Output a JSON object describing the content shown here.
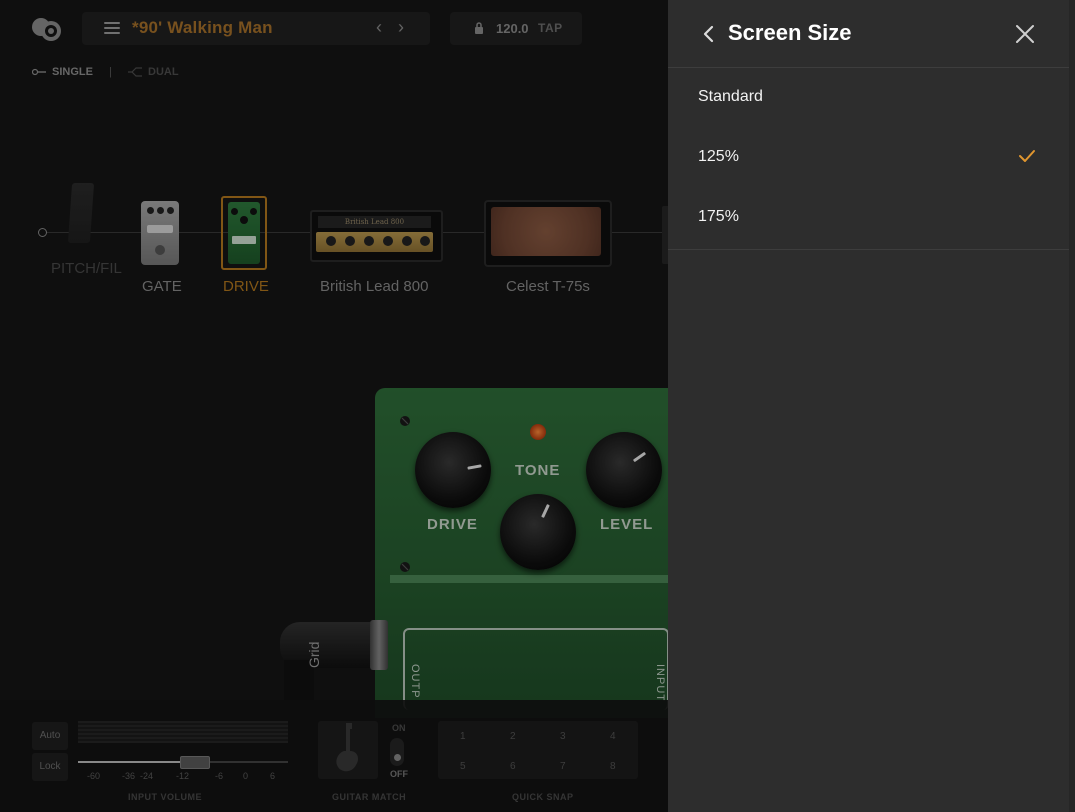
{
  "header": {
    "preset_name": "*90' Walking Man",
    "tempo": "120.0",
    "tap_label": "TAP"
  },
  "mode": {
    "single_label": "SINGLE",
    "separator": "|",
    "dual_label": "DUAL"
  },
  "chain": {
    "blocks": [
      {
        "label": "PITCH/FIL"
      },
      {
        "label": "GATE"
      },
      {
        "label": "DRIVE"
      },
      {
        "label": "British Lead 800"
      },
      {
        "label": "Celest T-75s"
      }
    ],
    "amp_plate_text": "British Lead 800"
  },
  "pedal": {
    "knob_labels": [
      "DRIVE",
      "TONE",
      "LEVEL"
    ],
    "output_label": "OUTP",
    "input_label": "INPUT",
    "cable_text": "Grid"
  },
  "bottom": {
    "auto_label": "Auto",
    "lock_label": "Lock",
    "ticks": [
      "-60",
      "-36",
      "-24",
      "-12",
      "-6",
      "0",
      "6"
    ],
    "input_volume_label": "INPUT VOLUME",
    "input_volume_value": "-12",
    "guitar_match_label": "GUITAR MATCH",
    "on_label": "ON",
    "off_label": "OFF",
    "quick_snap_label": "QUICK SNAP",
    "snaps": [
      "1",
      "2",
      "3",
      "4",
      "5",
      "6",
      "7",
      "8"
    ]
  },
  "panel": {
    "title": "Screen Size",
    "options": [
      {
        "label": "Standard",
        "selected": false
      },
      {
        "label": "125%",
        "selected": true
      },
      {
        "label": "175%",
        "selected": false
      }
    ]
  },
  "colors": {
    "accent": "#e0962f",
    "preset_name": "#a7712a",
    "panel_bg": "#2d2d2d",
    "pedal_green": "#2f6e3a"
  }
}
